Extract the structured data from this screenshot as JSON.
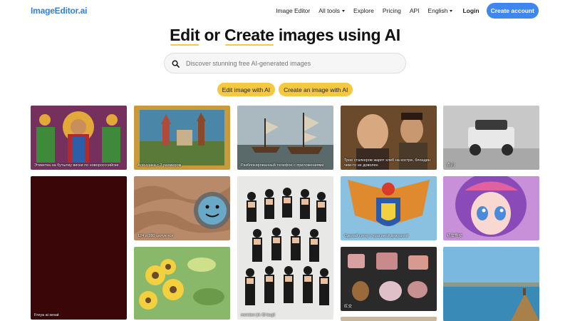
{
  "nav": {
    "logo": "ImageEditor.ai",
    "links": [
      "Image Editor",
      "All tools",
      "Explore",
      "Pricing",
      "API",
      "English"
    ],
    "login": "Login",
    "create_account": "Create account"
  },
  "hero": {
    "title_parts": [
      "Edit",
      " or ",
      "Create",
      " images using AI"
    ]
  },
  "search": {
    "placeholder": "Discover stunning free AI-generated images"
  },
  "cta": {
    "edit": "Edit image with AI",
    "create": "Create an image with AI"
  },
  "gallery": {
    "captions": [
      "Этикетка на бутылку виски по новоросссийски",
      "Алёнушка с 3 размером",
      "Разблокированный телефон с приложениями",
      "Трое сталкеров жарят хлеб на костре, блондин чем-то не доволен",
      "喜河",
      "Freya ai sesat",
      "124 и 380 целуются",
      "member jkt 48 bugil",
      "Сделай сигну с красивой девушкой",
      "初女性交",
      "红交"
    ]
  },
  "colors": {
    "brand": "#2f7fd8",
    "primary_button": "#3f86ee",
    "accent": "#f5c842"
  }
}
